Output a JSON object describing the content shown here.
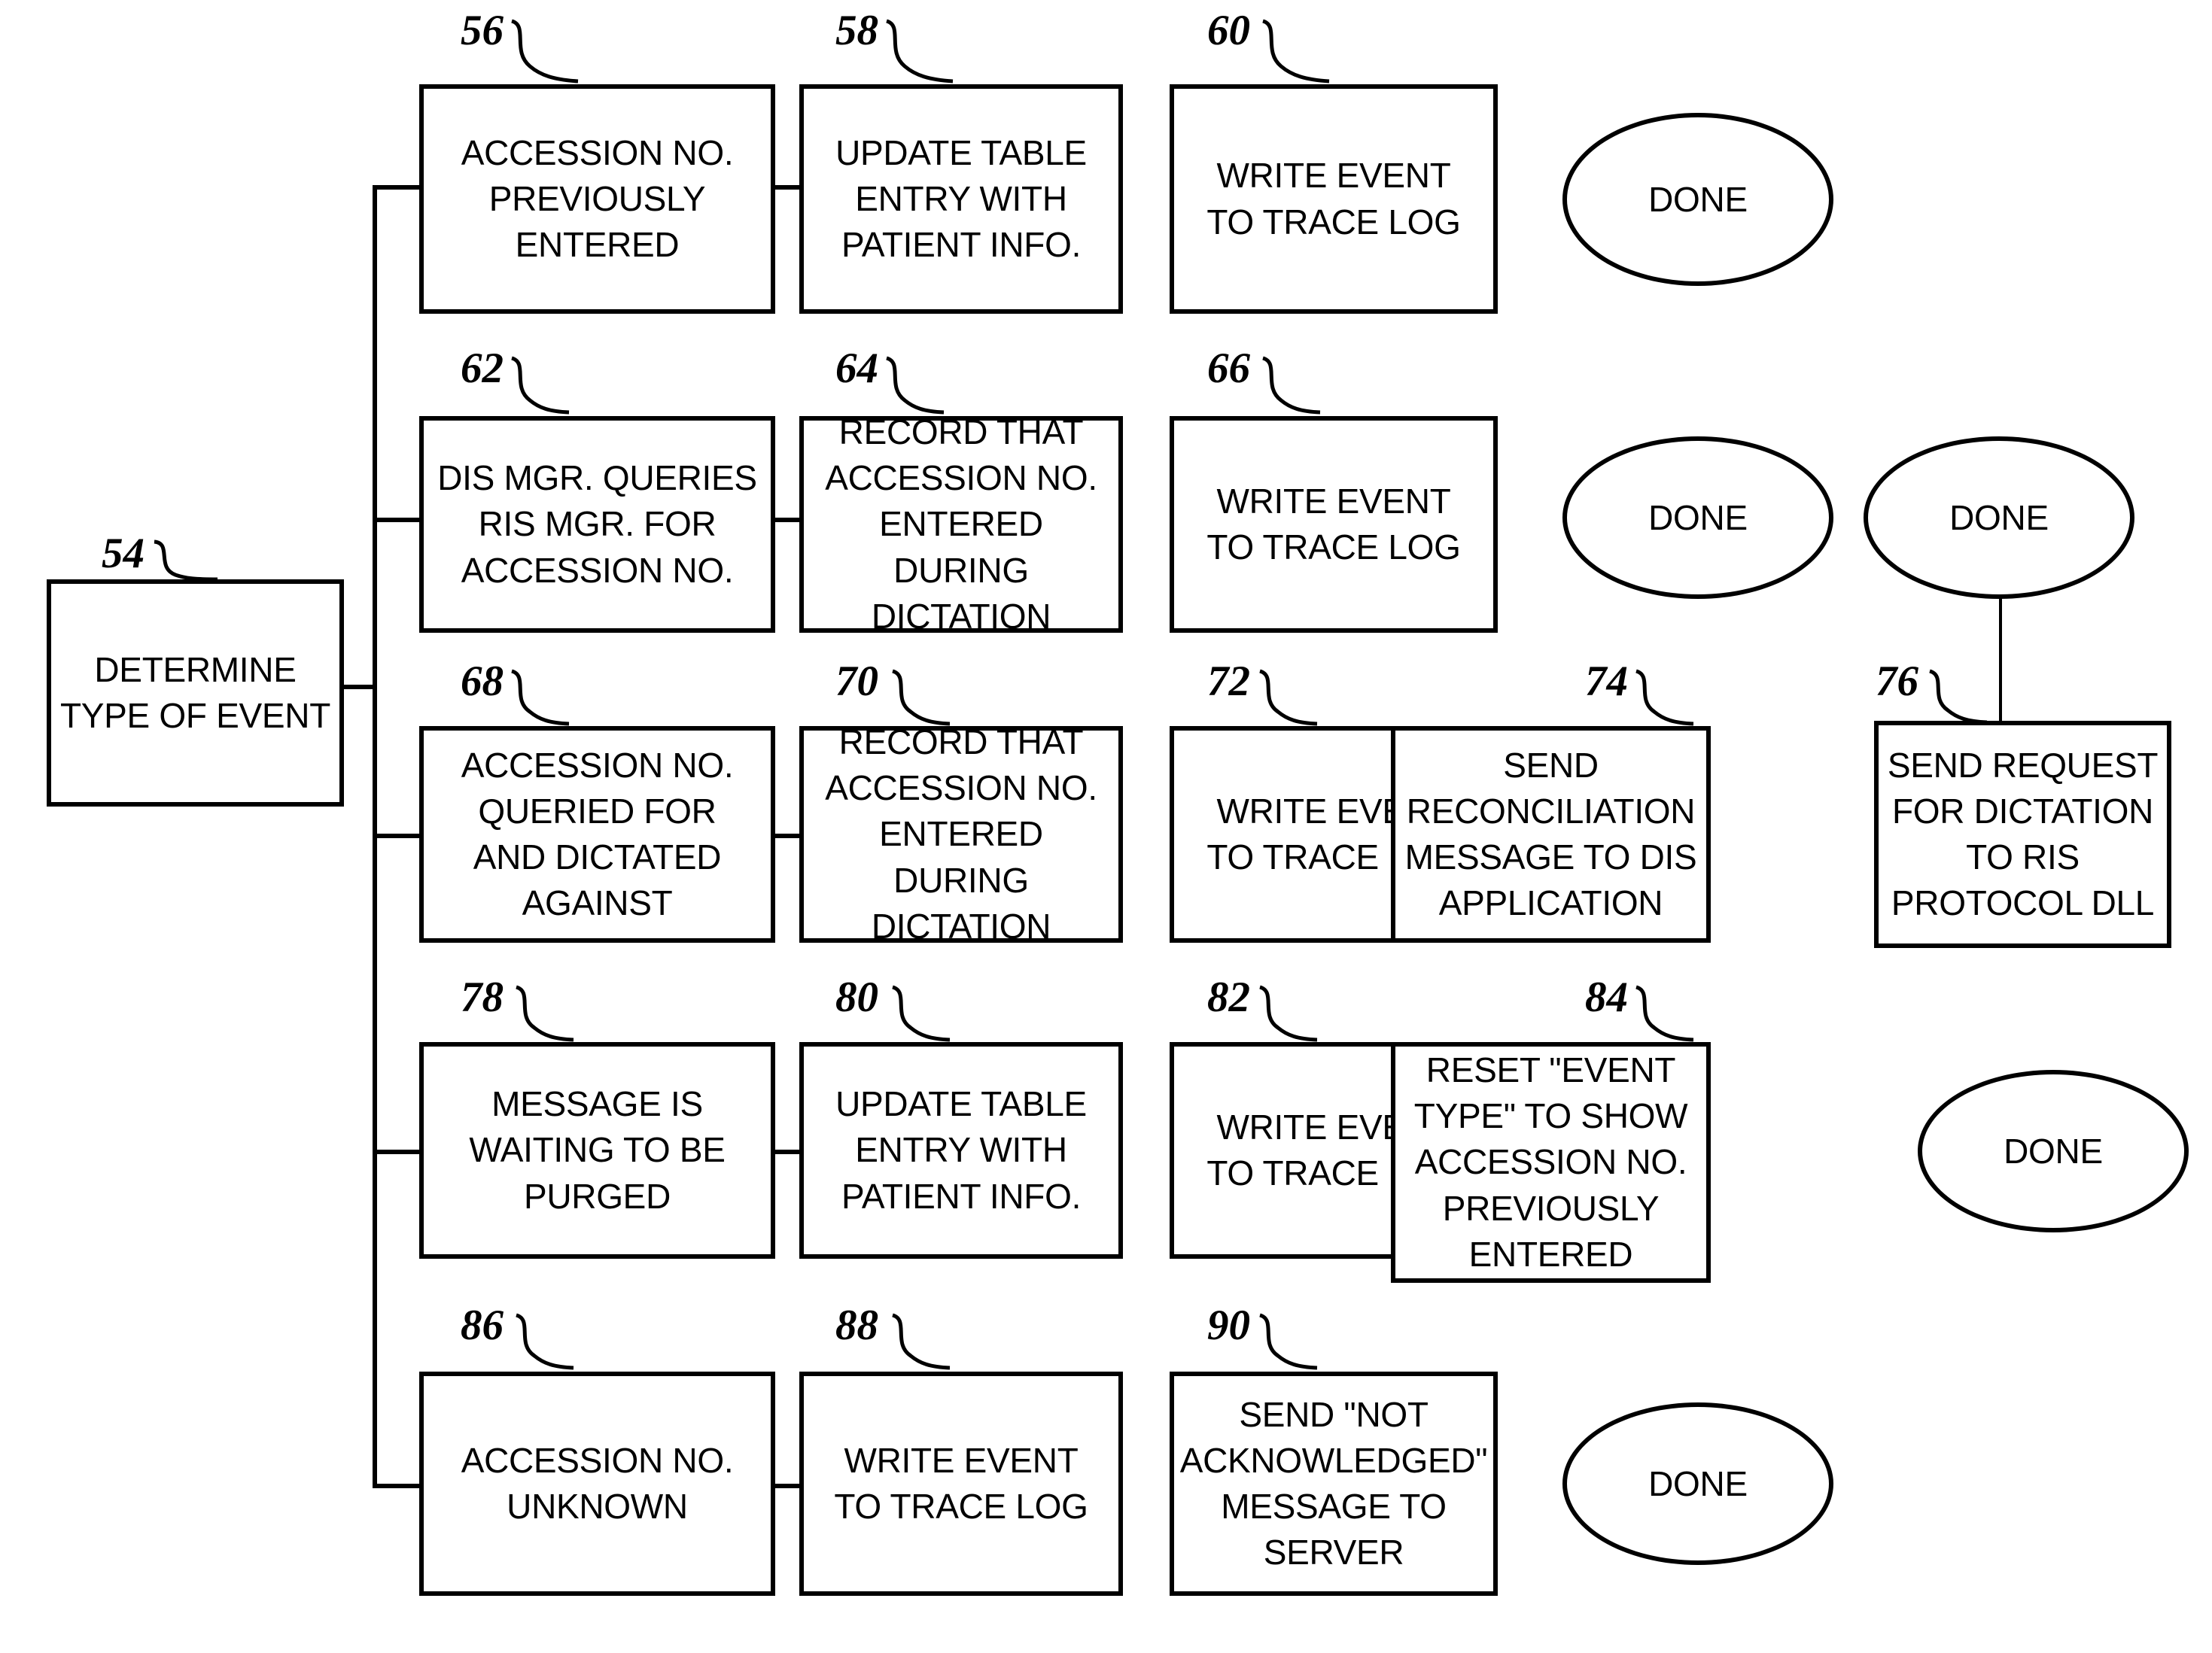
{
  "figure": {
    "kind": "patent-flowchart",
    "background_color": "#ffffff",
    "line_color": "#000000"
  },
  "nodes": [
    {
      "id": "n54",
      "ref": "54",
      "shape": "rect",
      "text": "DETERMINE\nTYPE OF EVENT"
    },
    {
      "id": "n56",
      "ref": "56",
      "shape": "rect",
      "text": "ACCESSION NO.\nPREVIOUSLY\nENTERED"
    },
    {
      "id": "n58",
      "ref": "58",
      "shape": "rect",
      "text": "UPDATE TABLE\nENTRY WITH\nPATIENT INFO."
    },
    {
      "id": "n60",
      "ref": "60",
      "shape": "rect",
      "text": "WRITE EVENT\nTO TRACE LOG"
    },
    {
      "id": "n62",
      "ref": "62",
      "shape": "rect",
      "text": "DIS MGR. QUERIES\nRIS MGR. FOR\nACCESSION NO."
    },
    {
      "id": "n64",
      "ref": "64",
      "shape": "rect",
      "text": "RECORD THAT\nACCESSION NO.\nENTERED DURING\nDICTATION"
    },
    {
      "id": "n66",
      "ref": "66",
      "shape": "rect",
      "text": "WRITE EVENT\nTO TRACE LOG"
    },
    {
      "id": "n68",
      "ref": "68",
      "shape": "rect",
      "text": "ACCESSION NO.\nQUERIED FOR\nAND DICTATED\nAGAINST"
    },
    {
      "id": "n70",
      "ref": "70",
      "shape": "rect",
      "text": "RECORD THAT\nACCESSION NO.\nENTERED DURING\nDICTATION"
    },
    {
      "id": "n72",
      "ref": "72",
      "shape": "rect",
      "text": "WRITE EVENT\nTO TRACE LOG"
    },
    {
      "id": "n74",
      "ref": "74",
      "shape": "rect",
      "text": "SEND\nRECONCILIATION\nMESSAGE TO DIS\nAPPLICATION"
    },
    {
      "id": "n76",
      "ref": "76",
      "shape": "rect",
      "text": "SEND REQUEST\nFOR DICTATION\nTO RIS\nPROTOCOL DLL"
    },
    {
      "id": "n78",
      "ref": "78",
      "shape": "rect",
      "text": "MESSAGE IS\nWAITING TO BE\nPURGED"
    },
    {
      "id": "n80",
      "ref": "80",
      "shape": "rect",
      "text": "UPDATE TABLE\nENTRY WITH\nPATIENT INFO."
    },
    {
      "id": "n82",
      "ref": "82",
      "shape": "rect",
      "text": "WRITE EVENT\nTO TRACE LOG"
    },
    {
      "id": "n84",
      "ref": "84",
      "shape": "rect",
      "text": "RESET \"EVENT\nTYPE\" TO SHOW\nACCESSION NO.\nPREVIOUSLY\nENTERED"
    },
    {
      "id": "n86",
      "ref": "86",
      "shape": "rect",
      "text": "ACCESSION NO.\nUNKNOWN"
    },
    {
      "id": "n88",
      "ref": "88",
      "shape": "rect",
      "text": "WRITE EVENT\nTO TRACE LOG"
    },
    {
      "id": "n90",
      "ref": "90",
      "shape": "rect",
      "text": "SEND \"NOT\nACKNOWLEDGED\"\nMESSAGE TO\nSERVER"
    }
  ],
  "terminators": [
    {
      "id": "d1",
      "shape": "oval",
      "text": "DONE"
    },
    {
      "id": "d2",
      "shape": "oval",
      "text": "DONE"
    },
    {
      "id": "d3",
      "shape": "oval",
      "text": "DONE"
    },
    {
      "id": "d4",
      "shape": "oval",
      "text": "DONE"
    },
    {
      "id": "d5",
      "shape": "oval",
      "text": "DONE"
    }
  ],
  "rows": [
    {
      "index": 1,
      "sequence": [
        "56",
        "58",
        "60",
        "DONE"
      ]
    },
    {
      "index": 2,
      "sequence": [
        "62",
        "64",
        "66",
        "DONE"
      ]
    },
    {
      "index": 3,
      "sequence": [
        "68",
        "70",
        "72",
        "74",
        "76"
      ]
    },
    {
      "index": 4,
      "sequence": [
        "78",
        "80",
        "82",
        "84",
        "DONE"
      ]
    },
    {
      "index": 5,
      "sequence": [
        "86",
        "88",
        "90",
        "DONE"
      ]
    }
  ],
  "extra_links": [
    {
      "from": "DONE",
      "to": "76",
      "orientation": "vertical"
    }
  ]
}
